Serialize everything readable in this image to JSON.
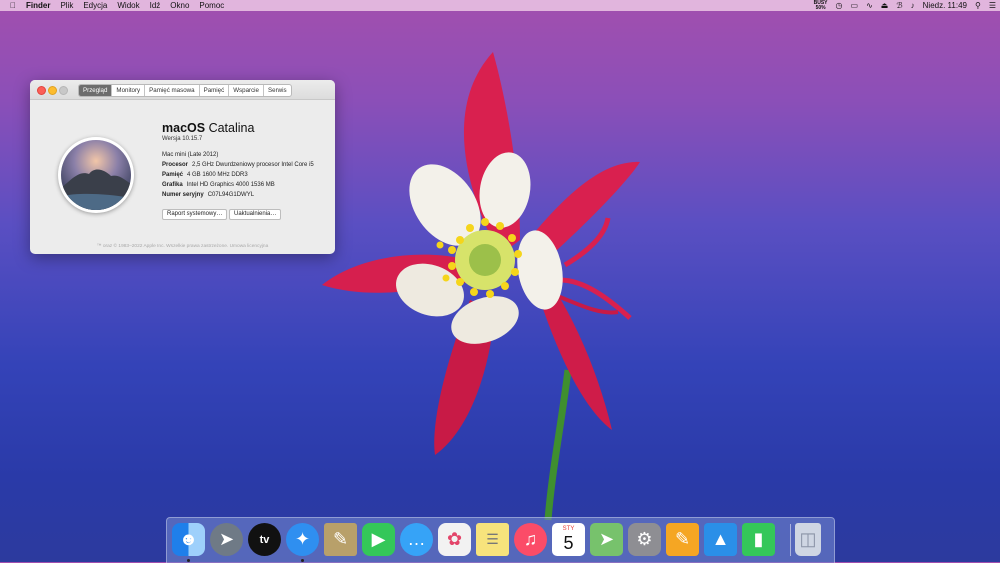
{
  "menubar": {
    "apple": "",
    "items": [
      "Finder",
      "Plik",
      "Edycja",
      "Widok",
      "Idź",
      "Okno",
      "Pomoc"
    ],
    "battery": [
      "BUSY",
      "50%"
    ],
    "clock": "Niedz. 11:49",
    "icons": [
      "battery-icon",
      "time-machine-icon",
      "wifi-icon",
      "eject-icon",
      "bluetooth-icon",
      "volume-icon",
      "search-icon",
      "control-center-icon"
    ]
  },
  "window": {
    "tabs": [
      "Przegląd",
      "Monitory",
      "Pamięć masowa",
      "Pamięć",
      "Wsparcie",
      "Serwis"
    ],
    "active_tab": "Przegląd",
    "os_name_bold": "macOS",
    "os_name_rest": " Catalina",
    "version": "Wersja 10.15.7",
    "model": "Mac mini (Late 2012)",
    "specs": [
      {
        "key": "Procesor",
        "value": "2,5 GHz Dwurdzeniowy procesor Intel Core i5"
      },
      {
        "key": "Pamięć",
        "value": "4 GB 1600 MHz DDR3"
      },
      {
        "key": "Grafika",
        "value": "Intel HD Graphics 4000 1536 MB"
      },
      {
        "key": "Numer seryjny",
        "value": "C07L94G1DWYL"
      }
    ],
    "btn_report": "Raport systemowy…",
    "btn_updates": "Uaktualnienia…",
    "copyright": "™ oraz © 1983–2022 Apple Inc. Wszelkie prawa zastrzeżone. Umowa licencyjna"
  },
  "dock": {
    "apps": [
      {
        "name": "Finder",
        "icon": "finder-icon",
        "color": "#3e9df5",
        "running": true
      },
      {
        "name": "Launchpad",
        "icon": "launchpad-icon",
        "color": "#6f7a86",
        "running": false
      },
      {
        "name": "TV",
        "icon": "apple-tv-icon",
        "color": "#111111",
        "running": false
      },
      {
        "name": "Safari",
        "icon": "safari-icon",
        "color": "#2f8ff0",
        "running": true
      },
      {
        "name": "Preview",
        "icon": "preview-icon",
        "color": "#b8a06a",
        "running": false
      },
      {
        "name": "FaceTime",
        "icon": "facetime-icon",
        "color": "#34c759",
        "running": false
      },
      {
        "name": "Messages",
        "icon": "messages-icon",
        "color": "#36a3f7",
        "running": false
      },
      {
        "name": "Photos",
        "icon": "photos-icon",
        "color": "#f2f2f2",
        "running": false
      },
      {
        "name": "Notes",
        "icon": "notes-icon",
        "color": "#f7e37c",
        "running": false
      },
      {
        "name": "Music",
        "icon": "music-icon",
        "color": "#fb4c68",
        "running": false
      },
      {
        "name": "Calendar",
        "icon": "calendar-icon",
        "color": "#ffffff",
        "running": false,
        "month": "STY",
        "day": "5"
      },
      {
        "name": "Maps",
        "icon": "maps-icon",
        "color": "#77c26c",
        "running": false
      },
      {
        "name": "System Preferences",
        "icon": "system-preferences-icon",
        "color": "#8e8e93",
        "running": false
      },
      {
        "name": "Pages",
        "icon": "pages-icon",
        "color": "#f5a623",
        "running": false
      },
      {
        "name": "Keynote",
        "icon": "keynote-icon",
        "color": "#2a8fe8",
        "running": false
      },
      {
        "name": "Numbers",
        "icon": "numbers-icon",
        "color": "#34c759",
        "running": false
      },
      {
        "name": "Trash",
        "icon": "trash-icon",
        "color": "#cfd6e3",
        "running": false
      }
    ]
  }
}
